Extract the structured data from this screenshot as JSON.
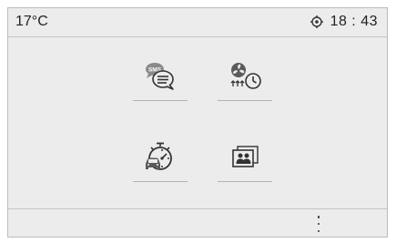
{
  "status": {
    "temperature": "17°C",
    "time": "18 : 43",
    "time_icon": "gps-clock-icon"
  },
  "main": {
    "tiles": [
      {
        "icon": "sms-message-icon",
        "badge": "SMS"
      },
      {
        "icon": "fan-heater-timer-icon"
      },
      {
        "icon": "car-timer-icon"
      },
      {
        "icon": "contacts-icon"
      }
    ]
  },
  "bottom": {
    "more_icon": "more-options-icon"
  },
  "colors": {
    "background": "#ececec",
    "icon": "#333333",
    "divider": "#c4c4c4"
  }
}
